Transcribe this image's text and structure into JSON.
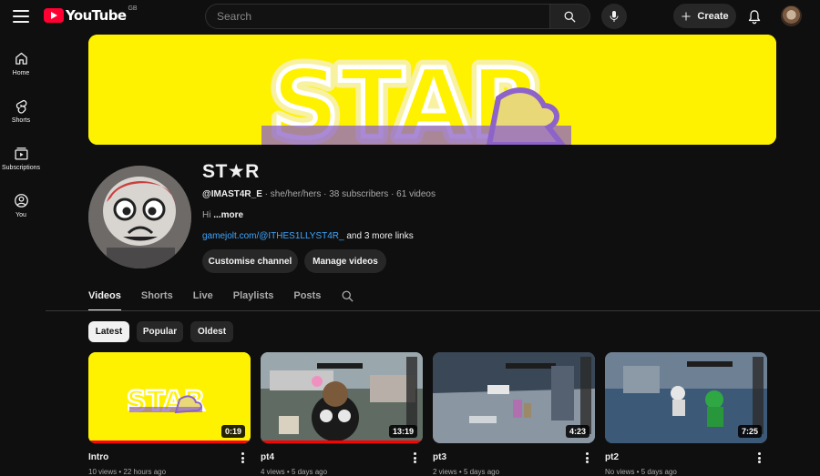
{
  "header": {
    "logo_text": "YouTube",
    "region": "GB",
    "search_placeholder": "Search",
    "create_label": "Create",
    "icons": [
      "menu-icon",
      "search-icon",
      "mic-icon",
      "plus-icon",
      "bell-icon"
    ]
  },
  "sidebar": {
    "items": [
      {
        "label": "Home",
        "icon": "home-icon"
      },
      {
        "label": "Shorts",
        "icon": "shorts-icon"
      },
      {
        "label": "Subscriptions",
        "icon": "subscriptions-icon"
      },
      {
        "label": "You",
        "icon": "you-icon"
      }
    ]
  },
  "banner": {
    "text": "STAR",
    "bg_color": "#fff200"
  },
  "channel": {
    "name": "ST★R",
    "handle": "@IMAST4R_E",
    "pronouns": "she/her/hers",
    "subscribers": "38 subscribers",
    "videos": "61 videos",
    "description": "Hi",
    "more_label": "...more",
    "link": "gamejolt.com/@ITHES1LLYST4R_",
    "more_links": "and 3 more links",
    "customise_label": "Customise channel",
    "manage_label": "Manage videos"
  },
  "tabs": [
    {
      "label": "Videos",
      "active": true
    },
    {
      "label": "Shorts",
      "active": false
    },
    {
      "label": "Live",
      "active": false
    },
    {
      "label": "Playlists",
      "active": false
    },
    {
      "label": "Posts",
      "active": false
    }
  ],
  "chips": [
    {
      "label": "Latest",
      "active": true
    },
    {
      "label": "Popular",
      "active": false
    },
    {
      "label": "Oldest",
      "active": false
    }
  ],
  "videos": [
    {
      "title": "Intro",
      "duration": "0:19",
      "views": "10 views",
      "age": "22 hours ago",
      "watched": 1.0
    },
    {
      "title": "pt4",
      "duration": "13:19",
      "views": "4 views",
      "age": "5 days ago",
      "watched": 1.0
    },
    {
      "title": "pt3",
      "duration": "4:23",
      "views": "2 views",
      "age": "5 days ago",
      "watched": 0.0
    },
    {
      "title": "pt2",
      "duration": "7:25",
      "views": "No views",
      "age": "5 days ago",
      "watched": 0.0
    }
  ],
  "colors": {
    "background": "#0f0f0f",
    "accent_red": "#ff0033",
    "link_blue": "#3ea6ff",
    "chip_bg": "#272727"
  }
}
